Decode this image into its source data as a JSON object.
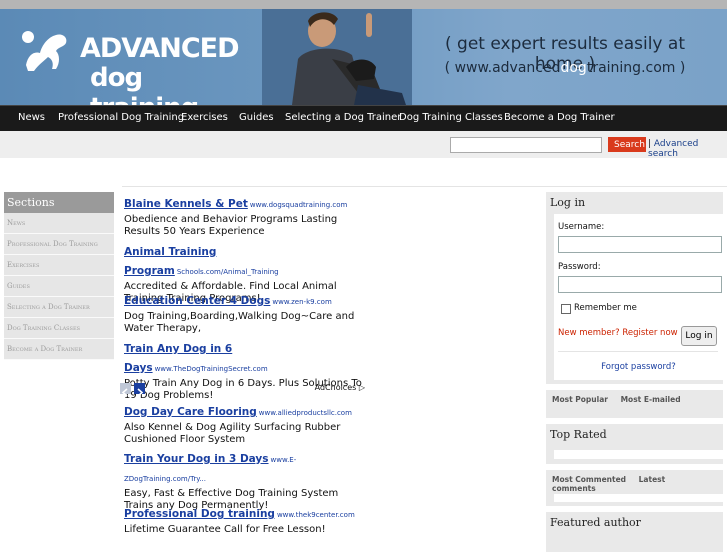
{
  "header": {
    "logo_line1": "ADVANCED",
    "logo_line2": "dog training",
    "tagline": "( get expert results easily at home )",
    "url_prefix": "( www.advanced",
    "url_highlight": "dog",
    "url_suffix": "training.com )"
  },
  "nav": {
    "items": [
      "News",
      "Professional Dog Training",
      "Exercises",
      "Guides",
      "Selecting a Dog Trainer",
      "Dog Training Classes",
      "Become a Dog Trainer"
    ]
  },
  "search": {
    "placeholder": "",
    "button_label": "Search",
    "separator": "|",
    "advanced_label": "Advanced search"
  },
  "sidebar": {
    "heading": "Sections",
    "items": [
      "News",
      "Professional Dog Training",
      "Exercises",
      "Guides",
      "Selecting a Dog Trainer",
      "Dog Training Classes",
      "Become a Dog Trainer"
    ]
  },
  "ads": {
    "items": [
      {
        "title": "Blaine Kennels & Pet",
        "site": "www.dogsquadtraining.com",
        "desc": "Obedience and Behavior Programs Lasting Results 50 Years Experience"
      },
      {
        "title": "Animal Training Program",
        "site": "Schools.com/Animal_Training",
        "desc": "Accredited & Affordable. Find Local Animal Training Training Programs!"
      },
      {
        "title": "Education Center 4 Dogs",
        "site": "www.zen-k9.com",
        "desc": "Dog Training,Boarding,Walking Dog~Care and Water Therapy,"
      },
      {
        "title": "Train Any Dog in 6 Days",
        "site": "www.TheDogTrainingSecret.com",
        "desc": "Potty Train Any Dog in 6 Days. Plus Solutions To 19 Dog Problems!"
      },
      {
        "title": "Dog Day Care Flooring",
        "site": "www.alliedproductsllc.com",
        "desc": "Also Kennel & Dog Agility Surfacing Rubber Cushioned Floor System"
      },
      {
        "title": "Train Your Dog in 3 Days",
        "site": "www.E-ZDogTraining.com/Try...",
        "desc": "Easy, Fast & Effective Dog Training System Trains any Dog Permanently!"
      },
      {
        "title": "Professional Dog training",
        "site": "www.thek9center.com",
        "desc": "Lifetime Guarantee Call for Free Lesson!"
      }
    ],
    "adchoices": "AdChoices"
  },
  "login": {
    "heading": "Log in",
    "username_label": "Username:",
    "password_label": "Password:",
    "remember_label": "Remember me",
    "new_member": "New member? Register now",
    "login_button": "Log in",
    "forgot": "Forgot password?"
  },
  "tabs1": {
    "a": "Most Popular",
    "b": "Most E-mailed"
  },
  "top_rated": {
    "heading": "Top Rated"
  },
  "tabs2": {
    "a": "Most Commented",
    "b": "Latest comments"
  },
  "featured": {
    "heading": "Featured author"
  },
  "colors": {
    "nav_bg": "#1a1a1a",
    "search_button": "#d93a1c",
    "link": "#1a3fa0",
    "register_red": "#cc2200"
  }
}
